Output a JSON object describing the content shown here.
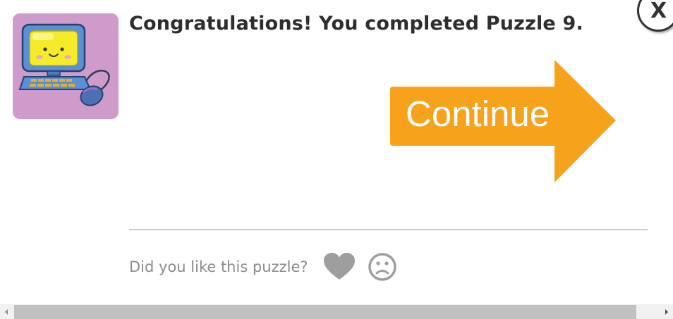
{
  "dialog": {
    "message": "Congratulations! You completed Puzzle 9.",
    "avatar_icon": "computer-mascot-icon",
    "continue_label": "Continue",
    "close_label": "X",
    "feedback_prompt": "Did you like this puzzle?",
    "like_icon": "heart-icon",
    "dislike_icon": "frown-face-icon"
  },
  "colors": {
    "continue_orange": "#f7a21b",
    "avatar_bg": "#cf9bcb",
    "message_text": "#2e2e2e",
    "muted_gray": "#8b8b8b"
  },
  "scrollbar": {
    "orientation": "horizontal"
  }
}
